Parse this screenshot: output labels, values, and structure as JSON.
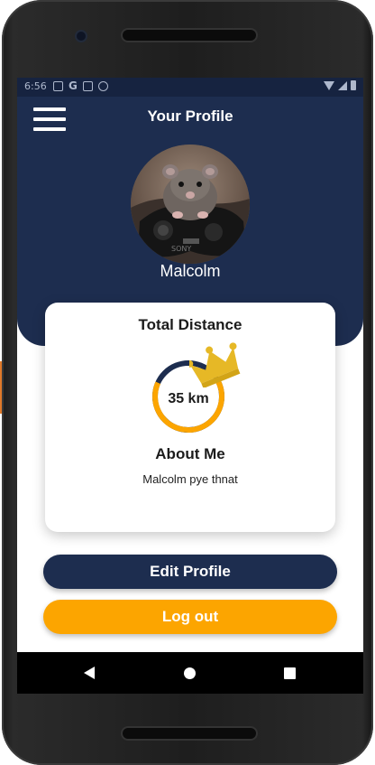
{
  "statusbar": {
    "time": "6:56"
  },
  "header": {
    "title": "Your Profile",
    "username": "Malcolm"
  },
  "card": {
    "total_distance_label": "Total Distance",
    "distance_value": "35 km",
    "distance_progress": 0.65,
    "about_title": "About Me",
    "about_text": "Malcolm pye thnat"
  },
  "buttons": {
    "edit_label": "Edit Profile",
    "logout_label": "Log out"
  },
  "colors": {
    "header_bg": "#1d2d4f",
    "accent_orange": "#fca500",
    "crown_gold": "#e6b826",
    "button_dark": "#1d2d4f"
  }
}
